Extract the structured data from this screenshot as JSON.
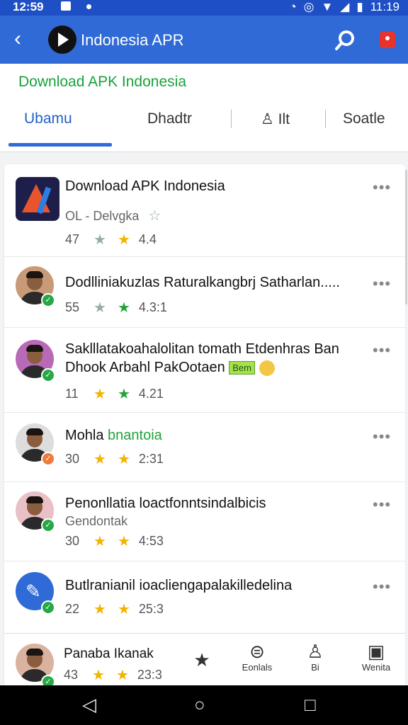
{
  "status_bar": {
    "time": "12:59",
    "clock": "11:19"
  },
  "app_bar": {
    "title": "Indonesia APR"
  },
  "sub_header": {
    "title": "Download APK Indonesia",
    "tabs": [
      "Ubamu",
      "Dhadtr",
      "Ilt",
      "Soatle"
    ]
  },
  "posts": [
    {
      "title": "Download APK Indonesia",
      "subtitle": "OL - Delvgka",
      "count": "47",
      "stat": "4.4"
    },
    {
      "title": "Dodlliniakuzlas Raturalkangbrj Satharlan.....",
      "count": "55",
      "stat": "4.3:1"
    },
    {
      "title": "Saklllatakoahalolitan tomath Etdenhras Ban",
      "title2": "Dhook Arbahl PakOotaen",
      "tag": "Bem",
      "count": "11",
      "stat": "4.21"
    },
    {
      "title": "Mohla",
      "title_green": "bnantoia",
      "count": "30",
      "stat": "2:31"
    },
    {
      "title": "Penonllatia loactfonntsindalbicis",
      "subtitle": "Gendontak",
      "count": "30",
      "stat": "4:53"
    },
    {
      "title": "Butlranianil ioacliengapalakilledelina",
      "count": "22",
      "stat": "25:3"
    },
    {
      "title": "Panaba Ikanak",
      "count": "43",
      "stat": "23:3"
    }
  ],
  "bottom_nav": [
    {
      "icon": "star-icon",
      "label": ""
    },
    {
      "icon": "globe-icon",
      "label": "Eonlals"
    },
    {
      "icon": "person-icon",
      "label": "Bi"
    },
    {
      "icon": "image-icon",
      "label": "Wenita"
    }
  ],
  "colors": {
    "app_bar": "#2f6ad6",
    "accent_green": "#22a33a",
    "star_gold": "#f2b400"
  }
}
